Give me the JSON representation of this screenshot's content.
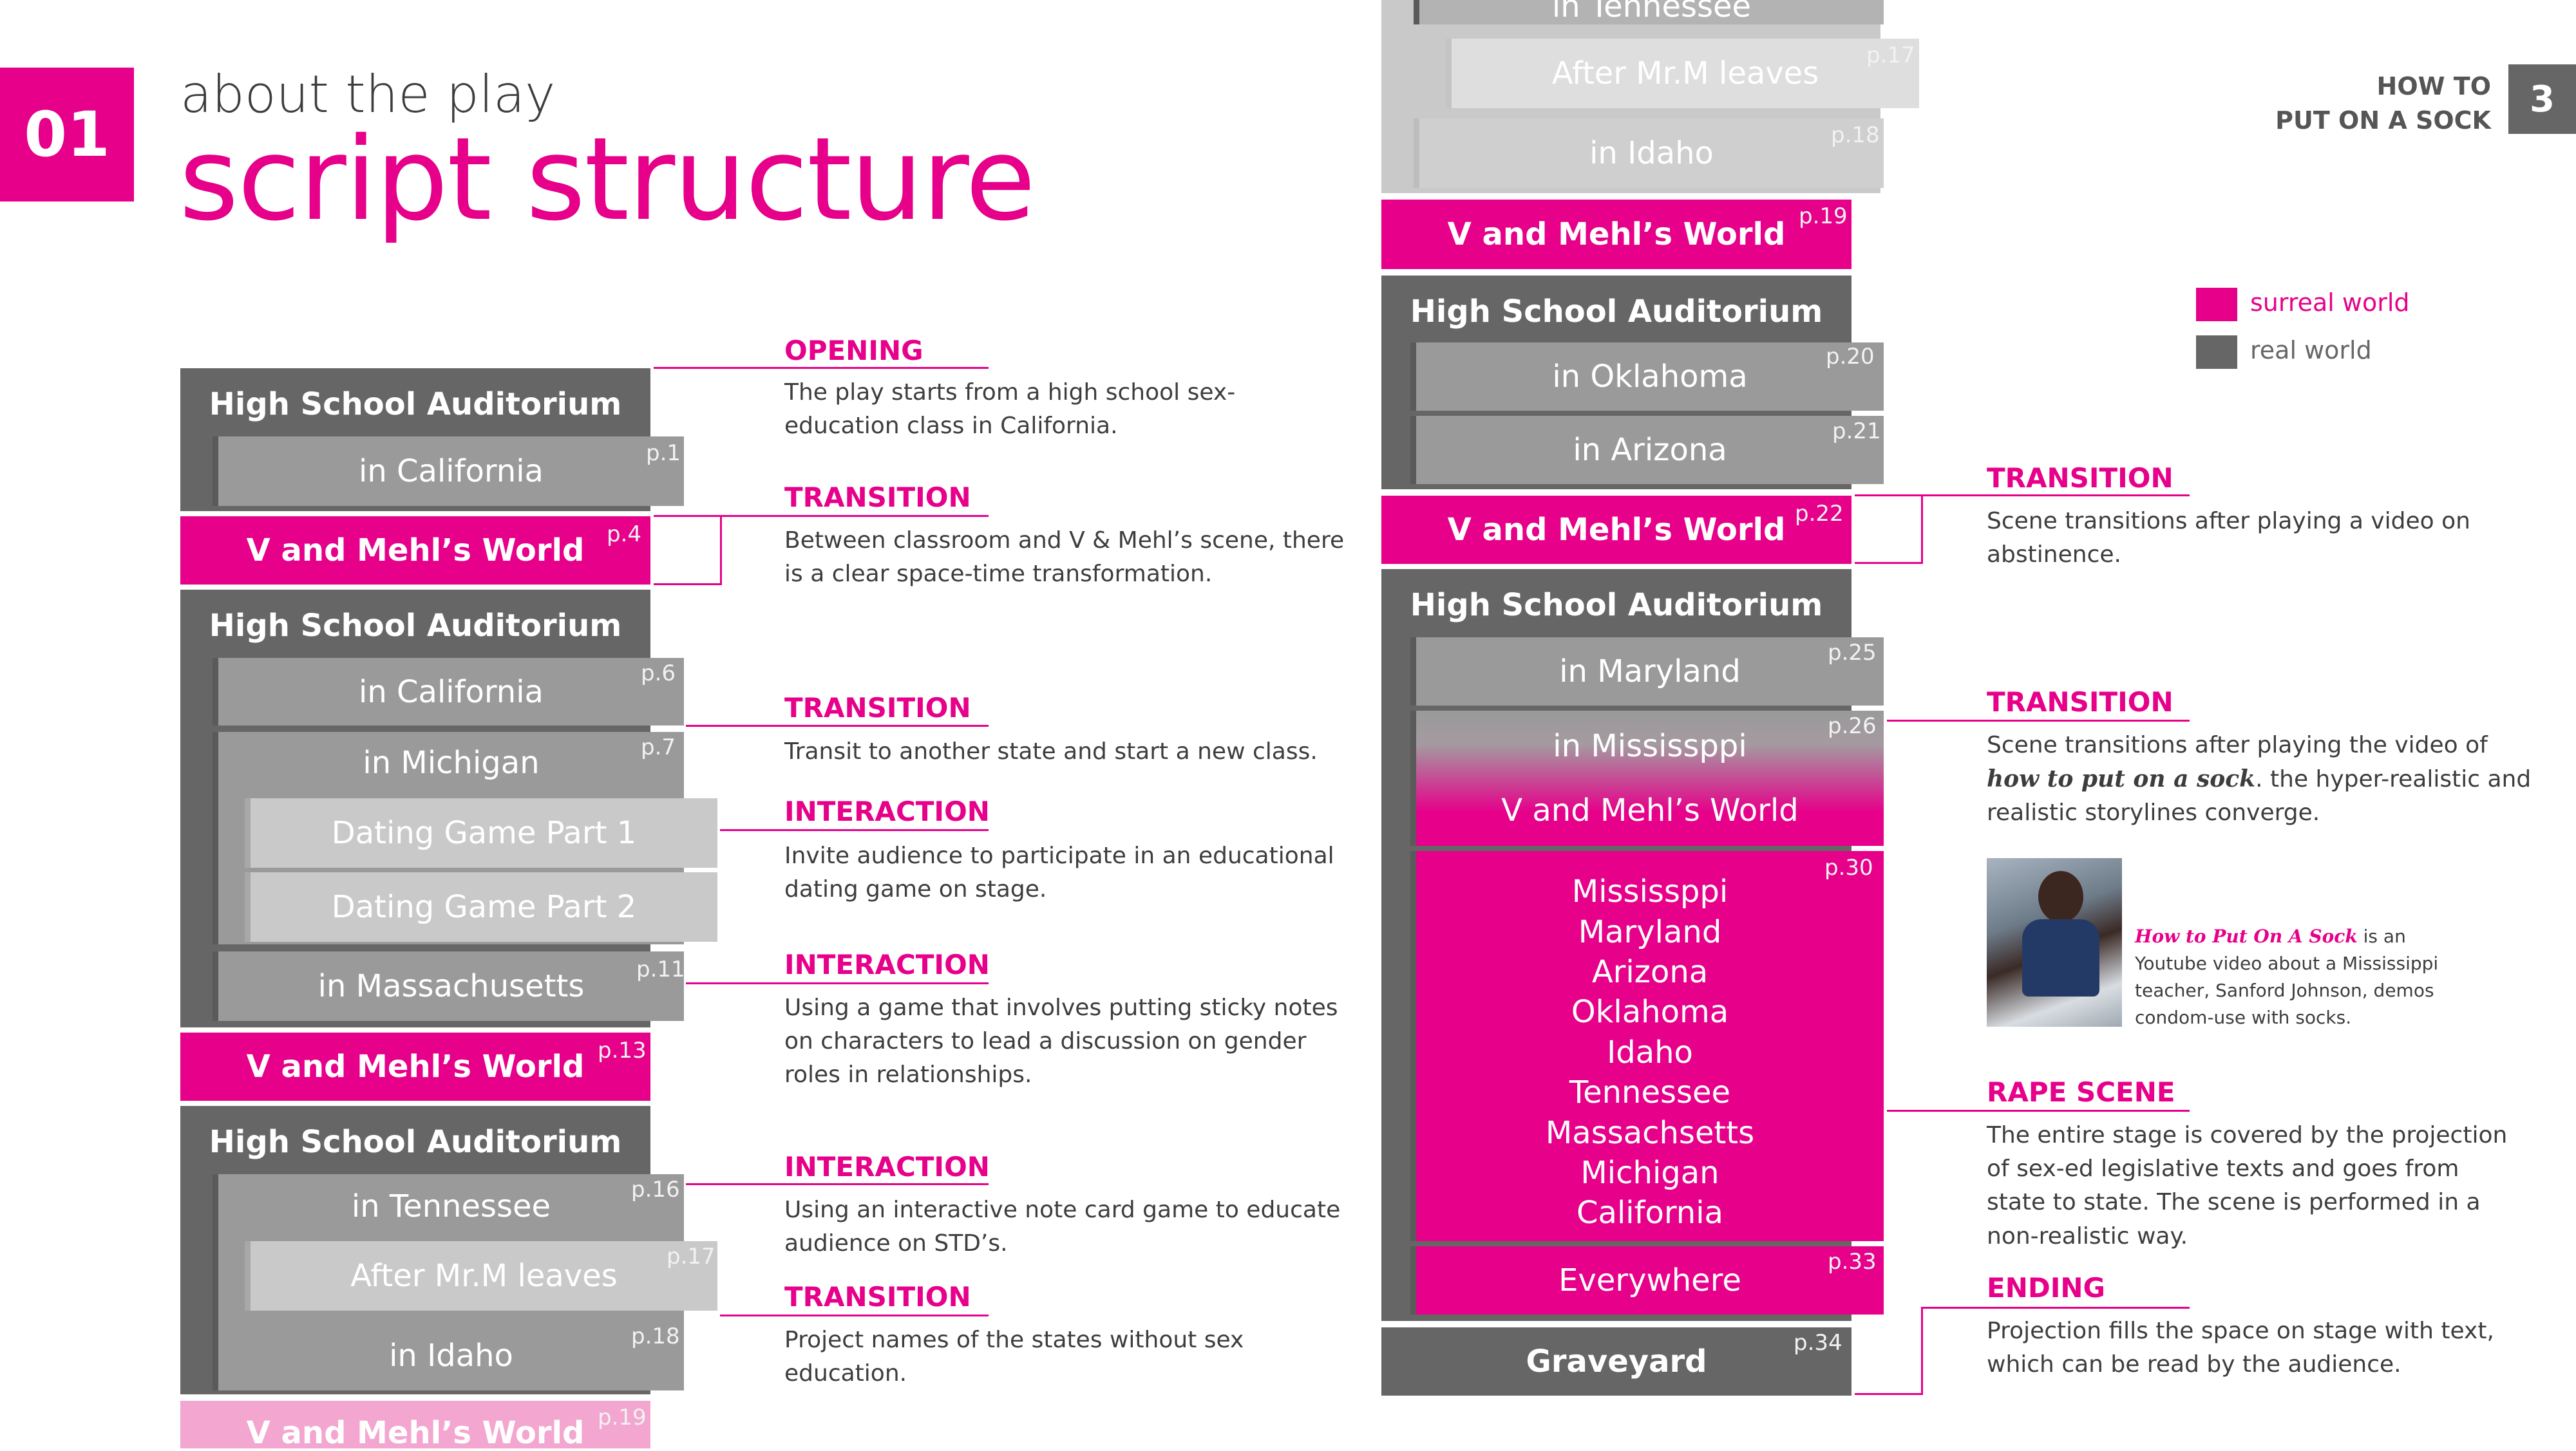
{
  "header": {
    "section_number": "01",
    "subtitle": "about the play",
    "title": "script structure",
    "book_title_line1": "HOW TO",
    "book_title_line2": "PUT ON A SOCK",
    "page_number": "3"
  },
  "legend": {
    "surreal": "surreal world",
    "real": "real world",
    "surreal_color": "#e6008a",
    "real_color": "#666666"
  },
  "left_column": {
    "hs1": "High School Auditorium",
    "california1": "in California",
    "california1_page": "p.1",
    "world1": "V and Mehl’s World",
    "world1_page": "p.4",
    "hs2": "High School Auditorium",
    "california2": "in California",
    "california2_page": "p.6",
    "michigan": "in Michigan",
    "michigan_page": "p.7",
    "dating1": "Dating Game Part 1",
    "dating2": "Dating Game Part 2",
    "massachusetts": "in Massachusetts",
    "massachusetts_page": "p.11",
    "world2": "V and Mehl’s World",
    "world2_page": "p.13",
    "hs3": "High School Auditorium",
    "tennessee": "in Tennessee",
    "tennessee_page": "p.16",
    "after_mr_m": "After Mr.M leaves",
    "after_mr_m_page": "p.17",
    "idaho": "in Idaho",
    "idaho_page": "p.18",
    "world3": "V and Mehl’s World",
    "world3_page": "p.19"
  },
  "right_column": {
    "tennessee": "in Tennessee",
    "after_mr_m": "After Mr.M leaves",
    "after_mr_m_page": "p.17",
    "idaho": "in Idaho",
    "idaho_page": "p.18",
    "world1": "V and Mehl’s World",
    "world1_page": "p.19",
    "hs1": "High School Auditorium",
    "oklahoma": "in Oklahoma",
    "oklahoma_page": "p.20",
    "arizona": "in Arizona",
    "arizona_page": "p.21",
    "world2": "V and Mehl’s World",
    "world2_page": "p.22",
    "hs2": "High School Auditorium",
    "maryland": "in Maryland",
    "maryland_page": "p.25",
    "mississippi": "in Mississppi",
    "mississippi_page": "p.26",
    "world3": "V and Mehl’s World",
    "states_page": "p.30",
    "states": [
      "Mississppi",
      "Maryland",
      "Arizona",
      "Oklahoma",
      "Idaho",
      "Tennessee",
      "Massachsetts",
      "Michigan",
      "California"
    ],
    "everywhere": "Everywhere",
    "everywhere_page": "p.33",
    "graveyard": "Graveyard",
    "graveyard_page": "p.34"
  },
  "notes_left": [
    {
      "heading": "OPENING",
      "text": "The play starts from a high school sex-education class in California."
    },
    {
      "heading": "TRANSITION",
      "text": "Between classroom and V & Mehl’s scene, there is a clear space-time transformation."
    },
    {
      "heading": "TRANSITION",
      "text": "Transit to another state and start a new class."
    },
    {
      "heading": "INTERACTION",
      "text": "Invite audience to participate in an educational dating game on stage."
    },
    {
      "heading": "INTERACTION",
      "text": "Using a game that involves putting sticky notes on characters to lead a discussion on gender roles in relationships."
    },
    {
      "heading": "INTERACTION",
      "text": "Using an interactive note card game to educate audience on STD’s."
    },
    {
      "heading": "TRANSITION",
      "text": "Project names of the states without sex education."
    }
  ],
  "notes_right": [
    {
      "heading": "TRANSITION",
      "text": "Scene transitions after playing a video on abstinence."
    },
    {
      "heading": "TRANSITION",
      "text_before": "Scene transitions after playing the video of ",
      "text_italic": "how to put on a sock",
      "text_after": ". the hyper-realistic and realistic storylines converge."
    },
    {
      "heading": "RAPE SCENE",
      "text": "The entire stage is covered by the projection of sex-ed legislative texts and goes from state to state. The scene is performed in a non-realistic way."
    },
    {
      "heading": "ENDING",
      "text": "Projection fills the space on stage with text, which can be read by the audience."
    }
  ],
  "video": {
    "title": "How to Put On A Sock",
    "caption": " is an Youtube video about a Mississippi teacher, Sanford Johnson, demos condom-use with socks."
  }
}
